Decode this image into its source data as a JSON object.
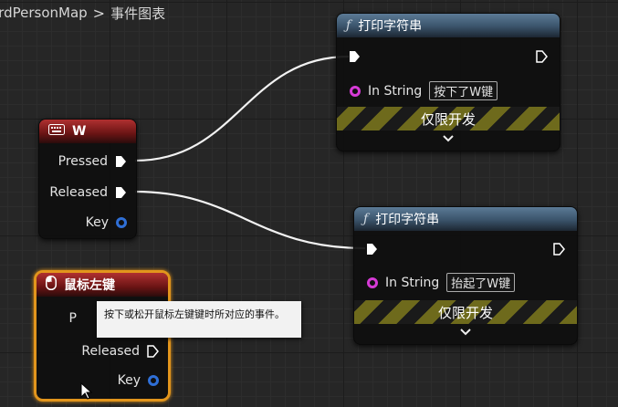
{
  "breadcrumb": {
    "parent": "irdPersonMap",
    "separator": ">",
    "current": "事件图表"
  },
  "key_w_node": {
    "title": "W",
    "pins": {
      "pressed": "Pressed",
      "released": "Released",
      "key": "Key"
    }
  },
  "print_node_1": {
    "title": "打印字符串",
    "in_string_label": "In String",
    "in_string_value": "按下了W键",
    "dev_only": "仅限开发"
  },
  "print_node_2": {
    "title": "打印字符串",
    "in_string_label": "In String",
    "in_string_value": "抬起了W键",
    "dev_only": "仅限开发"
  },
  "mouse_node": {
    "title": "鼠标左键",
    "pins": {
      "pressed": "P",
      "released": "Released",
      "key": "Key"
    }
  },
  "tooltip": {
    "text": "按下或松开鼠标左键键时所对应的事件。"
  },
  "colors": {
    "event_header": "#9c2626",
    "function_header": "#4a6784",
    "selection": "#e2951c",
    "string_pin": "#d63ad6",
    "struct_pin": "#2f6fd6",
    "dev_stripe": "#6e6a1c"
  },
  "icons": {
    "keyboard": "keyboard-icon",
    "mouse": "mouse-icon",
    "function": "function-icon"
  }
}
